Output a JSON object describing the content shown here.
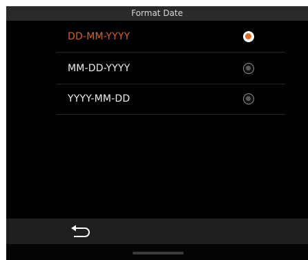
{
  "header": {
    "title": "Format Date"
  },
  "options": [
    {
      "label": "DD-MM-YYYY",
      "selected": true
    },
    {
      "label": "MM-DD-YYYY",
      "selected": false
    },
    {
      "label": "YYYY-MM-DD",
      "selected": false
    }
  ],
  "bottom_bar": {
    "back_icon": "back-arrow-icon"
  },
  "colors": {
    "accent": "#e36a21",
    "selected_text": "#d9621e",
    "text": "#ededed",
    "background": "#000000",
    "title_bar": "#2a2a2a",
    "bottom_bar": "#1f1f1f"
  }
}
